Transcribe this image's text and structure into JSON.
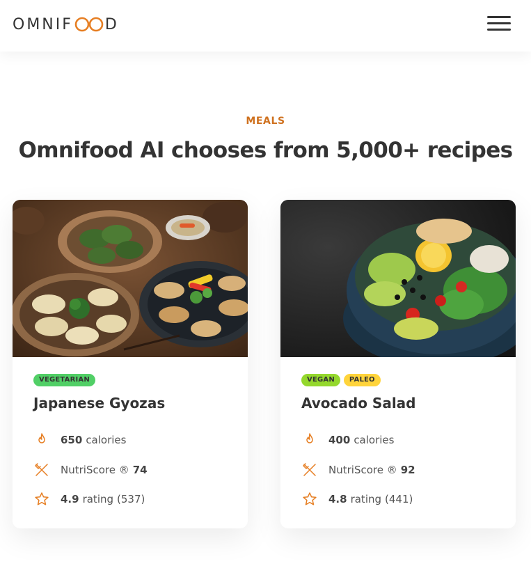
{
  "header": {
    "logo": {
      "prefix": "OMNIF",
      "suffix": "D"
    },
    "menu_icon": "hamburger-menu-icon"
  },
  "section": {
    "label": "MEALS",
    "title": "Omnifood AI chooses from 5,000+ recipes"
  },
  "meals": [
    {
      "title": "Japanese Gyozas",
      "tags": [
        {
          "label": "VEGETARIAN",
          "color": "#51cf66"
        }
      ],
      "calories_value": "650",
      "calories_label": "calories",
      "nutri_label": "NutriScore ®",
      "nutri_value": "74",
      "rating_value": "4.9",
      "rating_label": "rating",
      "rating_count": "(537)"
    },
    {
      "title": "Avocado Salad",
      "tags": [
        {
          "label": "VEGAN",
          "color": "#94d82d"
        },
        {
          "label": "PALEO",
          "color": "#ffd43b"
        }
      ],
      "calories_value": "400",
      "calories_label": "calories",
      "nutri_label": "NutriScore ®",
      "nutri_value": "92",
      "rating_value": "4.8",
      "rating_label": "rating",
      "rating_count": "(441)"
    }
  ],
  "colors": {
    "accent": "#e67e22",
    "text": "#333333",
    "label": "#cf711f"
  }
}
